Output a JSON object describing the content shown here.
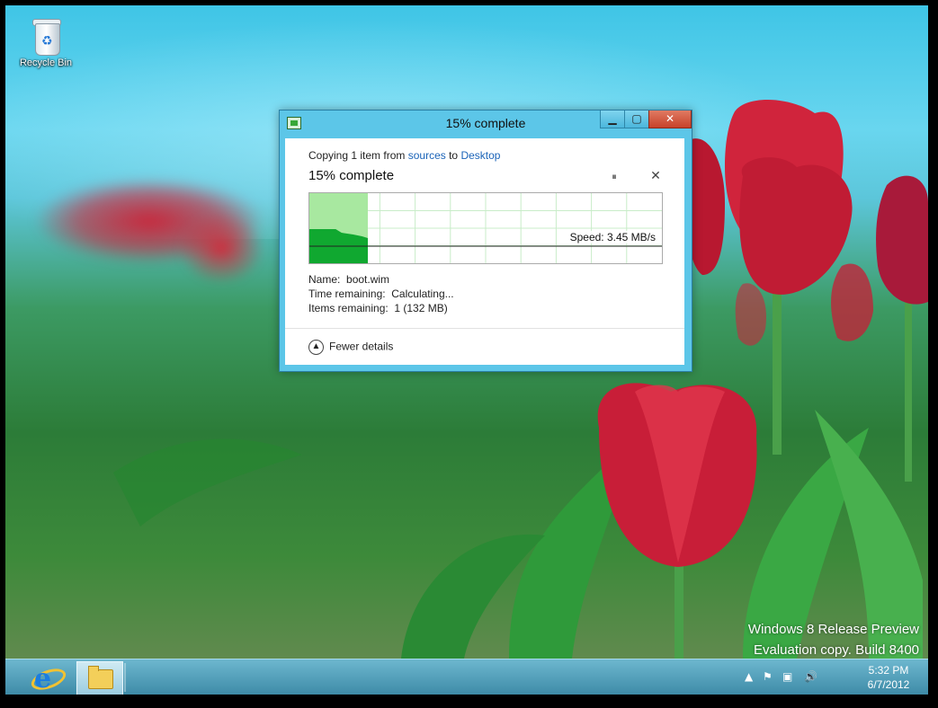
{
  "desktop": {
    "recycle_bin_label": "Recycle Bin",
    "watermark_line1": "Windows 8 Release Preview",
    "watermark_line2": "Evaluation copy. Build 8400"
  },
  "dialog": {
    "window_title": "15% complete",
    "copying_prefix": "Copying 1 item from ",
    "source_link": "sources",
    "to_word": " to ",
    "dest_link": "Desktop",
    "headline": "15% complete",
    "pause_glyph": "⏸",
    "cancel_glyph": "✕",
    "speed_text": "Speed: 3.45 MB/s",
    "details": {
      "name_label": "Name:",
      "name_value": "boot.wim",
      "time_label": "Time remaining:",
      "time_value": "Calculating...",
      "items_label": "Items remaining:",
      "items_value": "1 (132 MB)"
    },
    "fewer_details_label": "Fewer details",
    "progress_fraction": 0.15
  },
  "taskbar": {
    "time": "5:32 PM",
    "date": "6/7/2012",
    "pinned": [
      "internet-explorer-icon",
      "file-explorer-icon"
    ]
  },
  "colors": {
    "progress_light": "#a8e8a0",
    "progress_dark": "#10a830",
    "link": "#1a63b8",
    "close_button": "#c7412a"
  }
}
